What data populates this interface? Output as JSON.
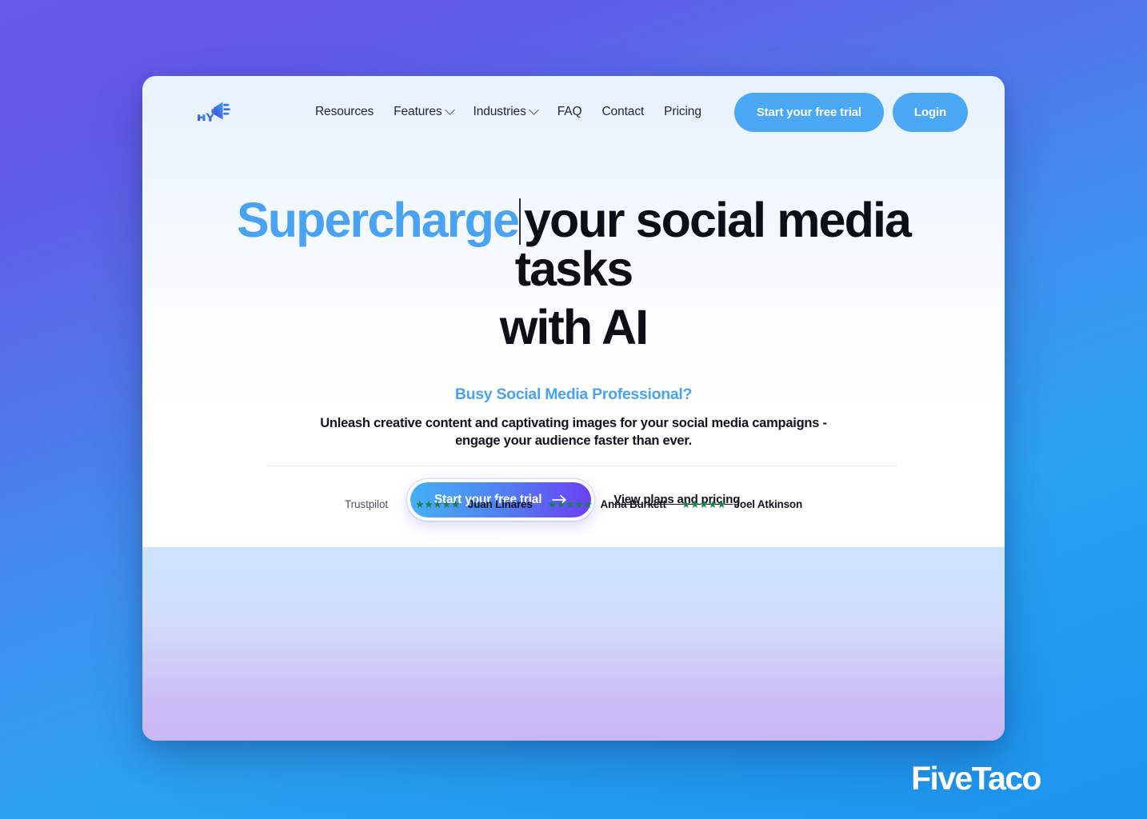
{
  "brand": {
    "logo_icon": "hype-megaphone-logo-icon",
    "logo_text": "HYPE"
  },
  "nav": {
    "links": [
      {
        "label": "Resources",
        "has_dropdown": false
      },
      {
        "label": "Features",
        "has_dropdown": true
      },
      {
        "label": "Industries",
        "has_dropdown": true
      },
      {
        "label": "FAQ",
        "has_dropdown": false
      },
      {
        "label": "Contact",
        "has_dropdown": false
      },
      {
        "label": "Pricing",
        "has_dropdown": false
      }
    ],
    "trial_button": "Start your free trial",
    "login_button": "Login"
  },
  "hero": {
    "headline_accent": "Supercharge",
    "headline_rest": "your social media tasks",
    "headline_line2": "with AI",
    "eyebrow": "Busy Social Media Professional?",
    "subcopy_line1": "Unleash creative content and captivating images for your social media campaigns -",
    "subcopy_line2": "engage your audience faster than ever.",
    "cta_button": "Start your free trial",
    "cta_arrow_icon": "arrow-right-icon",
    "secondary_link": "View plans and pricing"
  },
  "social_proof": {
    "source": "Trustpilot",
    "reviews": [
      {
        "stars": "★★★★★",
        "rating": 5,
        "name": "Juan Linares"
      },
      {
        "stars": "★★★★★",
        "rating": 5,
        "name": "Anna Burkett"
      },
      {
        "stars": "★★★★★",
        "rating": 5,
        "name": "Joel Atkinson"
      }
    ]
  },
  "watermark": {
    "text": "FiveTaco"
  },
  "colors": {
    "accent_blue": "#4aa2f2",
    "nav_button_blue": "#4aa8f5",
    "cta_gradient_from": "#45b0f4",
    "cta_gradient_to": "#6d3ef5",
    "star_green": "#1b7f52",
    "page_bg_top": "#6159e8",
    "page_bg_bottom": "#1e95ee",
    "lower_strip_top": "#cbe5fc",
    "lower_strip_bottom": "#c9b7f6",
    "heading_text": "#0c0f16"
  }
}
